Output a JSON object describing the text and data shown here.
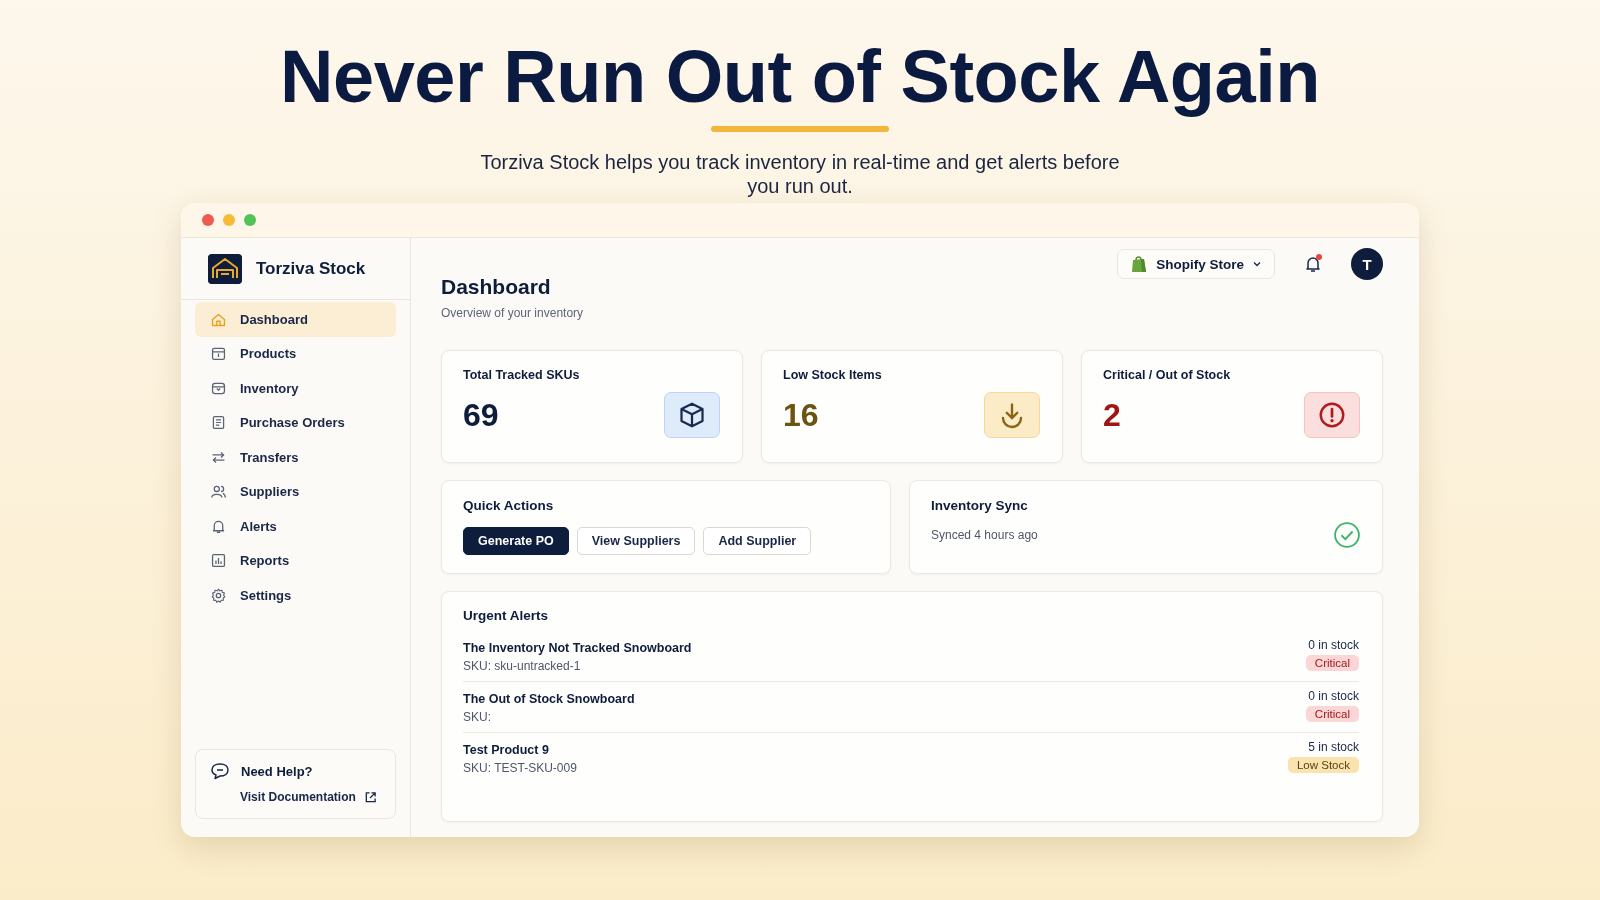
{
  "hero": {
    "title": "Never Run Out of Stock Again",
    "subtitle": "Torziva Stock helps you track inventory in real-time and get alerts before you run out."
  },
  "sidebar": {
    "brand": "Torziva Stock",
    "items": [
      {
        "label": "Dashboard",
        "selected": true
      },
      {
        "label": "Products",
        "selected": false
      },
      {
        "label": "Inventory",
        "selected": false
      },
      {
        "label": "Purchase Orders",
        "selected": false
      },
      {
        "label": "Transfers",
        "selected": false
      },
      {
        "label": "Suppliers",
        "selected": false
      },
      {
        "label": "Alerts",
        "selected": false
      },
      {
        "label": "Reports",
        "selected": false
      },
      {
        "label": "Settings",
        "selected": false
      }
    ],
    "help": {
      "title": "Need Help?",
      "link": "Visit Documentation"
    }
  },
  "header": {
    "title": "Dashboard",
    "subtitle": "Overview of your inventory",
    "store": "Shopify Store",
    "unread": true,
    "avatar": "T"
  },
  "stats": [
    {
      "label": "Total Tracked SKUs",
      "value": "69",
      "kind": "total"
    },
    {
      "label": "Low Stock Items",
      "value": "16",
      "kind": "low"
    },
    {
      "label": "Critical / Out of Stock",
      "value": "2",
      "kind": "critical"
    }
  ],
  "quick_actions": {
    "title": "Quick Actions",
    "buttons": [
      {
        "label": "Generate PO",
        "primary": true
      },
      {
        "label": "View Suppliers",
        "primary": false
      },
      {
        "label": "Add Supplier",
        "primary": false
      }
    ]
  },
  "sync": {
    "title": "Inventory Sync",
    "status": "Synced 4 hours ago",
    "ok": true
  },
  "alerts": {
    "title": "Urgent Alerts",
    "items": [
      {
        "name": "The Inventory Not Tracked Snowboard",
        "sku": "SKU: sku-untracked-1",
        "stock": "0 in stock",
        "badge": "Critical",
        "kind": "critical"
      },
      {
        "name": "The Out of Stock Snowboard",
        "sku": "SKU:",
        "stock": "0 in stock",
        "badge": "Critical",
        "kind": "critical"
      },
      {
        "name": "Test Product 9",
        "sku": "SKU: TEST-SKU-009",
        "stock": "5 in stock",
        "badge": "Low Stock",
        "kind": "low"
      }
    ]
  }
}
